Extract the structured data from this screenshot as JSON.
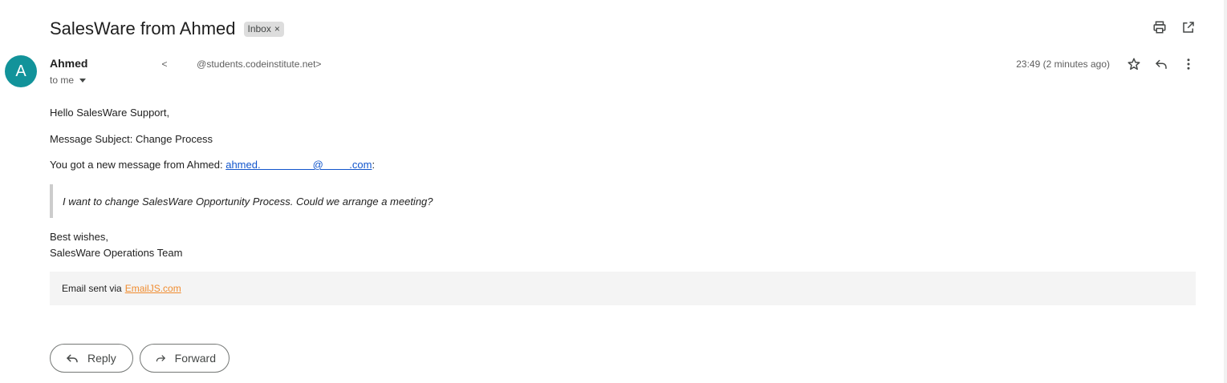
{
  "email": {
    "subject": "SalesWare from Ahmed",
    "label": "Inbox",
    "label_remove": "×",
    "sender": {
      "avatar_letter": "A",
      "name": "Ahmed",
      "email_display": "<           @students.codeinstitute.net>",
      "to": "to me"
    },
    "timestamp": "23:49 (2 minutes ago)",
    "body": {
      "greeting": "Hello SalesWare Support,",
      "subject_line": "Message Subject: Change Process",
      "new_message_prefix": "You got a new message from Ahmed: ",
      "link_text": "ahmed.                  @         .com",
      "link_suffix": ":",
      "quote": "I want to change SalesWare Opportunity Process. Could we arrange a meeting?",
      "signoff": "Best wishes,",
      "team": "SalesWare Operations Team"
    },
    "footer": {
      "prefix": "Email sent via",
      "link": "EmailJS.com"
    },
    "actions": {
      "reply": "Reply",
      "forward": "Forward"
    }
  },
  "colors": {
    "avatar": "#12939a",
    "link": "#1155cc",
    "footer_link": "#f08c2f",
    "footer_bg": "#f4f4f4"
  },
  "icons": [
    "print-icon",
    "open-in-new-window-icon",
    "star-icon",
    "reply-icon",
    "more-vert-icon",
    "forward-icon"
  ]
}
